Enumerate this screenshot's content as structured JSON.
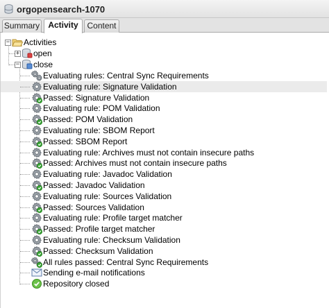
{
  "window": {
    "title": "orgopensearch-1070"
  },
  "tabs": [
    {
      "label": "Summary",
      "active": false
    },
    {
      "label": "Activity",
      "active": true
    },
    {
      "label": "Content",
      "active": false
    }
  ],
  "tree": {
    "root": {
      "label": "Activities",
      "icon": "folder-open-icon"
    },
    "open": {
      "label": "open",
      "icon": "repository-icon"
    },
    "close": {
      "label": "close",
      "icon": "repository-close-icon"
    },
    "items": [
      {
        "label": "Evaluating rules: Central Sync Requirements",
        "icon": "gears-icon"
      },
      {
        "label": "Evaluating rule: Signature Validation",
        "icon": "gear-icon"
      },
      {
        "label": "Passed: Signature Validation",
        "icon": "gear-passed-icon"
      },
      {
        "label": "Evaluating rule: POM Validation",
        "icon": "gear-icon"
      },
      {
        "label": "Passed: POM Validation",
        "icon": "gear-passed-icon"
      },
      {
        "label": "Evaluating rule: SBOM Report",
        "icon": "gear-icon"
      },
      {
        "label": "Passed: SBOM Report",
        "icon": "gear-passed-icon"
      },
      {
        "label": "Evaluating rule: Archives must not contain insecure paths",
        "icon": "gear-icon"
      },
      {
        "label": "Passed: Archives must not contain insecure paths",
        "icon": "gear-passed-icon"
      },
      {
        "label": "Evaluating rule: Javadoc Validation",
        "icon": "gear-icon"
      },
      {
        "label": "Passed: Javadoc Validation",
        "icon": "gear-passed-icon"
      },
      {
        "label": "Evaluating rule: Sources Validation",
        "icon": "gear-icon"
      },
      {
        "label": "Passed: Sources Validation",
        "icon": "gear-passed-icon"
      },
      {
        "label": "Evaluating rule: Profile target matcher",
        "icon": "gear-icon"
      },
      {
        "label": "Passed: Profile target matcher",
        "icon": "gear-passed-icon"
      },
      {
        "label": "Evaluating rule: Checksum Validation",
        "icon": "gear-icon"
      },
      {
        "label": "Passed: Checksum Validation",
        "icon": "gear-passed-icon"
      },
      {
        "label": "All rules passed: Central Sync Requirements",
        "icon": "gears-passed-icon"
      },
      {
        "label": "Sending e-mail notifications",
        "icon": "email-icon"
      },
      {
        "label": "Repository closed",
        "icon": "check-circle-icon"
      }
    ],
    "selected_index": 1
  }
}
